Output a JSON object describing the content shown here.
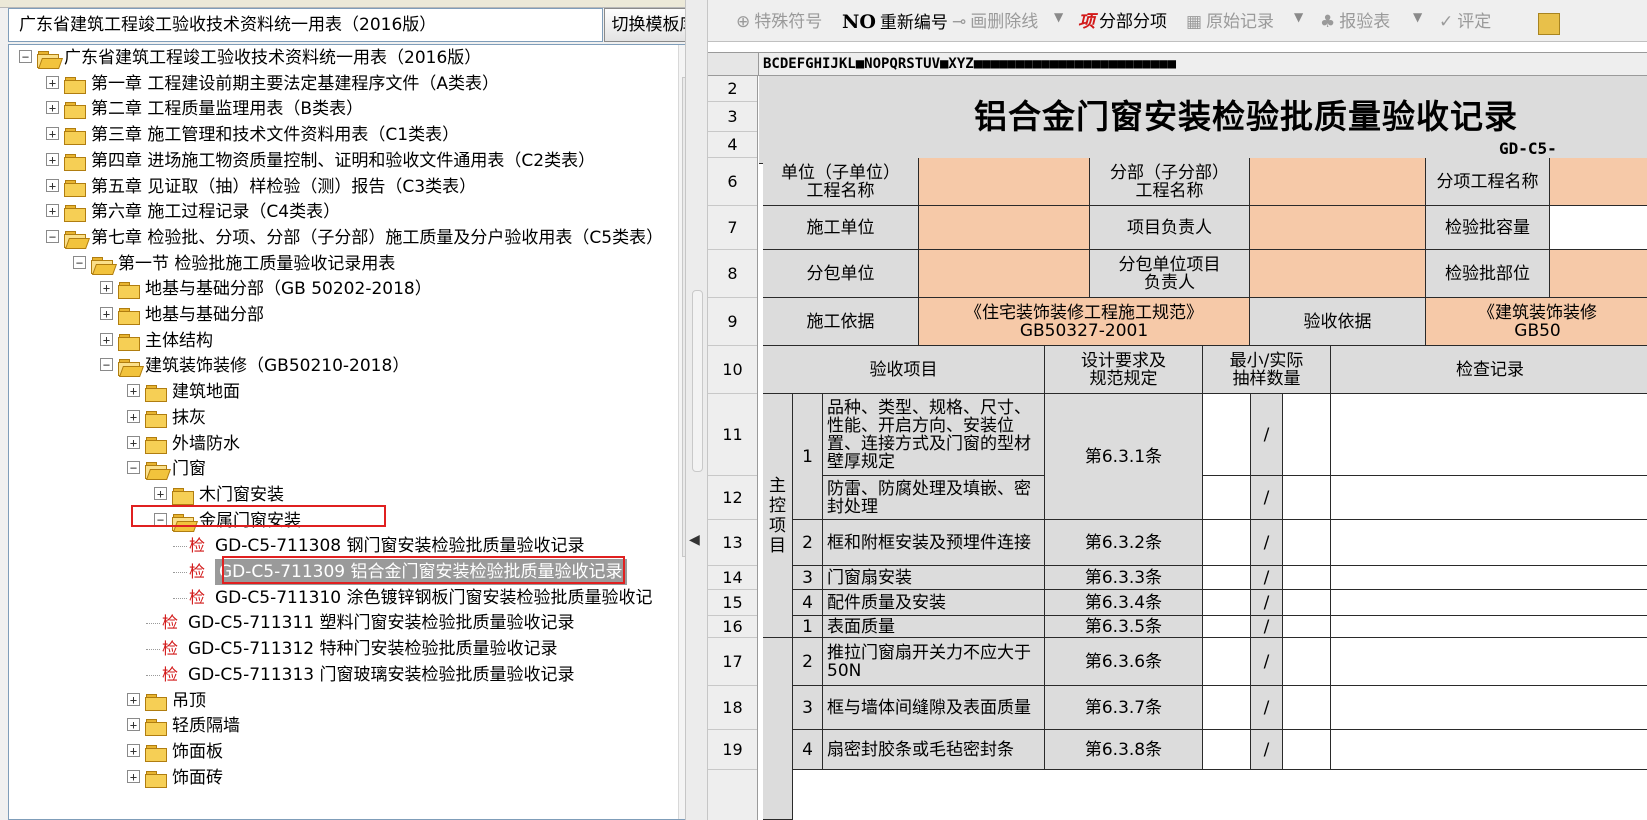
{
  "left_panel": {
    "template_title": "广东省建筑工程竣工验收技术资料统一用表（2016版）",
    "switch_button": "切换模板库",
    "tree": [
      {
        "label": "广东省建筑工程竣工验收技术资料统一用表（2016版）",
        "toggle": "−",
        "icon": "folder-open"
      },
      {
        "label": "第一章 工程建设前期主要法定基建程序文件（A类表）",
        "toggle": "+",
        "icon": "folder"
      },
      {
        "label": "第二章 工程质量监理用表（B类表）",
        "toggle": "+",
        "icon": "folder"
      },
      {
        "label": "第三章 施工管理和技术文件资料用表（C1类表）",
        "toggle": "+",
        "icon": "folder"
      },
      {
        "label": "第四章 进场施工物资质量控制、证明和验收文件通用表（C2类表）",
        "toggle": "+",
        "icon": "folder"
      },
      {
        "label": "第五章  见证取（抽）样检验（测）报告（C3类表）",
        "toggle": "+",
        "icon": "folder"
      },
      {
        "label": "第六章 施工过程记录（C4类表）",
        "toggle": "+",
        "icon": "folder"
      },
      {
        "label": "第七章 检验批、分项、分部（子分部）施工质量及分户验收用表（C5类表）",
        "toggle": "−",
        "icon": "folder-open"
      },
      {
        "label": "第一节 检验批施工质量验收记录用表",
        "toggle": "−",
        "icon": "folder-open"
      },
      {
        "label": "地基与基础分部（GB 50202-2018）",
        "toggle": "+",
        "icon": "folder"
      },
      {
        "label": "地基与基础分部",
        "toggle": "+",
        "icon": "folder"
      },
      {
        "label": "主体结构",
        "toggle": "+",
        "icon": "folder"
      },
      {
        "label": "建筑装饰装修（GB50210-2018）",
        "toggle": "−",
        "icon": "folder-open"
      },
      {
        "label": "建筑地面",
        "toggle": "+",
        "icon": "folder"
      },
      {
        "label": "抹灰",
        "toggle": "+",
        "icon": "folder"
      },
      {
        "label": "外墙防水",
        "toggle": "+",
        "icon": "folder"
      },
      {
        "label": "门窗",
        "toggle": "−",
        "icon": "folder-open"
      },
      {
        "label": "木门窗安装",
        "toggle": "+",
        "icon": "folder"
      },
      {
        "label": "金属门窗安装",
        "toggle": "−",
        "icon": "folder-open"
      },
      {
        "label": "GD-C5-711308 钢门窗安装检验批质量验收记录",
        "tag": "检"
      },
      {
        "label": "GD-C5-711309 铝合金门窗安装检验批质量验收记录",
        "tag": "检"
      },
      {
        "label": "GD-C5-711310 涂色镀锌钢板门窗安装检验批质量验收记",
        "tag": "检"
      },
      {
        "label": "GD-C5-711311 塑料门窗安装检验批质量验收记录",
        "tag": "检"
      },
      {
        "label": "GD-C5-711312 特种门安装检验批质量验收记录",
        "tag": "检"
      },
      {
        "label": "GD-C5-711313 门窗玻璃安装检验批质量验收记录",
        "tag": "检"
      },
      {
        "label": "吊顶",
        "toggle": "+",
        "icon": "folder"
      },
      {
        "label": "轻质隔墙",
        "toggle": "+",
        "icon": "folder"
      },
      {
        "label": "饰面板",
        "toggle": "+",
        "icon": "folder"
      },
      {
        "label": "饰面砖",
        "toggle": "+",
        "icon": "folder"
      }
    ]
  },
  "toolbar": {
    "special_symbol": "特殊符号",
    "renumber_icon_text": "NO",
    "renumber": "重新编号",
    "delete_line": "画删除线",
    "divide_icon_text": "项",
    "divide_items": "分部分项",
    "original_record": "原始记录",
    "report_check": "报验表",
    "evaluate": "评定"
  },
  "sheet": {
    "column_letters": "BCDEFGHIJKL■NOPQRSTUV■XYZ■■■■■■■■■■■■■■■■■■■■■■■■",
    "row_numbers": [
      "2",
      "3",
      "4",
      "6",
      "7",
      "8",
      "9",
      "10",
      "11",
      "12",
      "13",
      "14",
      "15",
      "16",
      "17",
      "18",
      "19"
    ],
    "form_title": "铝合金门窗安装检验批质量验收记录",
    "form_code": "GD-C5-",
    "labels": {
      "unit_project": "单位（子单位）\n工程名称",
      "division_project": "分部（子分部）\n工程名称",
      "item_project": "分项工程名称",
      "construction_unit": "施工单位",
      "project_manager": "项目负责人",
      "batch_capacity": "检验批容量",
      "subcontractor": "分包单位",
      "sub_manager": "分包单位项目\n负责人",
      "batch_location": "检验批部位",
      "construction_basis": "施工依据",
      "construction_basis_value": "《住宅装饰装修工程施工规范》\nGB50327-2001",
      "acceptance_basis": "验收依据",
      "acceptance_basis_value": "《建筑装饰装修\nGB50",
      "acceptance_items": "验收项目",
      "design_requirements": "设计要求及\n规范规定",
      "sample_count": "最小/实际\n抽样数量",
      "inspection_record": "检查记录",
      "main_control": "主\n控\n项\n目"
    },
    "items": [
      {
        "no": "1",
        "desc": "品种、类型、规格、尺寸、性能、开启方向、安装位置、连接方式及门窗的型材壁厚规定",
        "clause": "第6.3.1条",
        "slash": "/"
      },
      {
        "no": "",
        "desc": "防雷、防腐处理及填嵌、密封处理",
        "clause": "",
        "slash": "/"
      },
      {
        "no": "2",
        "desc": "框和附框安装及预埋件连接",
        "clause": "第6.3.2条",
        "slash": "/"
      },
      {
        "no": "3",
        "desc": "门窗扇安装",
        "clause": "第6.3.3条",
        "slash": "/"
      },
      {
        "no": "4",
        "desc": "配件质量及安装",
        "clause": "第6.3.4条",
        "slash": "/"
      },
      {
        "no": "1",
        "desc": "表面质量",
        "clause": "第6.3.5条",
        "slash": "/"
      },
      {
        "no": "2",
        "desc": "推拉门窗扇开关力不应大于50N",
        "clause": "第6.3.6条",
        "slash": "/"
      },
      {
        "no": "3",
        "desc": "框与墙体间缝隙及表面质量",
        "clause": "第6.3.7条",
        "slash": "/"
      },
      {
        "no": "4",
        "desc": "扇密封胶条或毛毡密封条",
        "clause": "第6.3.8条",
        "slash": "/"
      }
    ]
  },
  "colors": {
    "peach": "#f6c9a8",
    "gray_cell": "#dcdcdc",
    "selection": "#9a9a9a",
    "highlight_box": "#e02020",
    "tag_red": "#d21818"
  }
}
